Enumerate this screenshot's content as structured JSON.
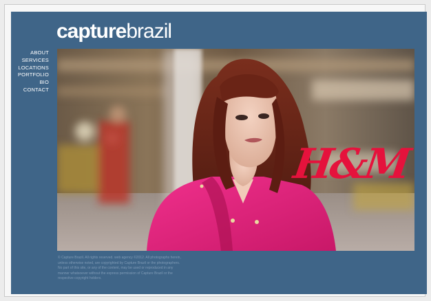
{
  "brand": {
    "name_bold": "capture",
    "name_light": "brazil"
  },
  "nav": {
    "items": [
      {
        "label": "ABOUT"
      },
      {
        "label": "SERVICES"
      },
      {
        "label": "LOCATIONS"
      },
      {
        "label": "PORTFOLIO"
      },
      {
        "label": "BIO"
      },
      {
        "label": "CONTACT"
      }
    ]
  },
  "hero": {
    "logo_text": "H&M"
  },
  "footer": {
    "copyright": "© Capture Brazil. All rights reserved. web agency ©2012. All photographs herein, unless otherwise noted, are copyrighted by Capture Brazil or the photographers. No part of this site, or any of the content, may be used or reproduced in any manner whatsoever without the express permission of Capture Brazil or the respective copyright holders."
  },
  "colors": {
    "panel": "#3f6588",
    "accent": "#e5123c",
    "text": "#ffffff"
  }
}
